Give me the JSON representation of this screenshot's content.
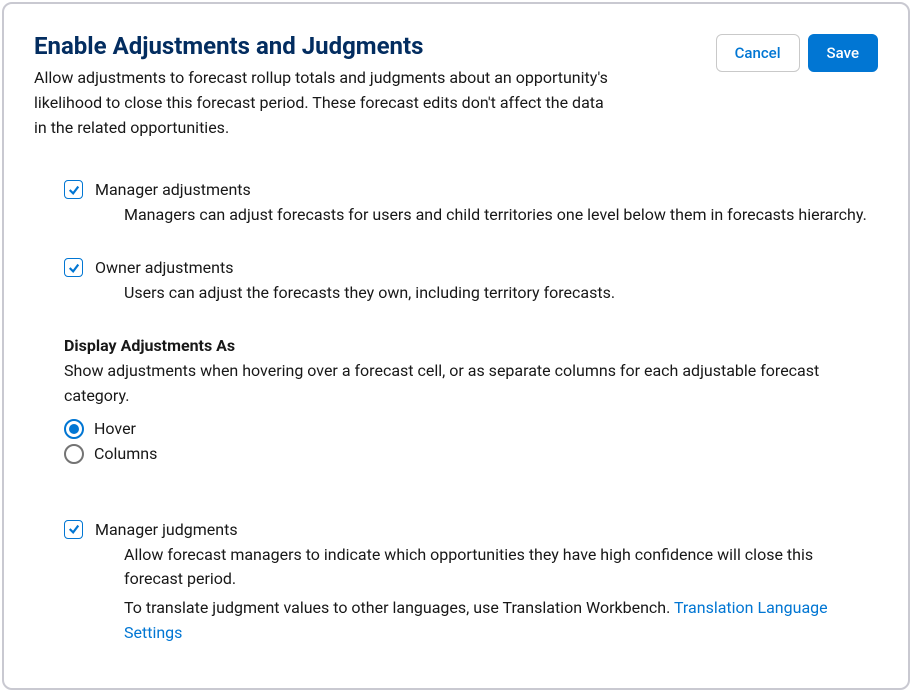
{
  "header": {
    "title": "Enable Adjustments and Judgments",
    "subtitle": "Allow adjustments to forecast rollup totals and judgments about an opportunity's likelihood to close this forecast period. These forecast edits don't affect the data in the related opportunities."
  },
  "buttons": {
    "cancel": "Cancel",
    "save": "Save"
  },
  "options": {
    "manager_adjustments": {
      "label": "Manager adjustments",
      "desc": "Managers can adjust forecasts for users and child territories one level below them in forecasts hierarchy.",
      "checked": true
    },
    "owner_adjustments": {
      "label": "Owner adjustments",
      "desc": "Users can adjust the forecasts they own, including territory forecasts.",
      "checked": true
    },
    "manager_judgments": {
      "label": "Manager judgments",
      "desc": "Allow forecast managers to indicate which opportunities they have high confidence will close this forecast period.",
      "desc2_prefix": "To translate judgment values to other languages, use Translation Workbench. ",
      "link": "Translation Language Settings",
      "checked": true
    }
  },
  "display_section": {
    "heading": "Display Adjustments As",
    "desc": "Show adjustments when hovering over a forecast cell, or as separate columns for each adjustable forecast category.",
    "radios": {
      "hover": "Hover",
      "columns": "Columns"
    },
    "selected": "hover"
  }
}
